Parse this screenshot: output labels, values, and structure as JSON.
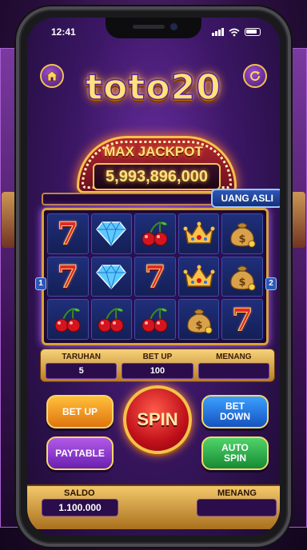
{
  "status": {
    "time": "12:41"
  },
  "header": {
    "logo": "toto20"
  },
  "jackpot": {
    "title": "MAX JACKPOT",
    "value": "5,993,896,000"
  },
  "badge": {
    "label": "UANG ASLI"
  },
  "reels": {
    "line_left": "1",
    "line_right": "2",
    "grid": [
      [
        "seven",
        "seven",
        "cherry"
      ],
      [
        "diamond",
        "diamond",
        "cherry"
      ],
      [
        "cherry",
        "seven",
        "cherry"
      ],
      [
        "crown",
        "crown",
        "moneybag"
      ],
      [
        "moneybag",
        "moneybag",
        "seven"
      ]
    ]
  },
  "bet": {
    "taruhan_label": "TARUHAN",
    "taruhan_value": "5",
    "betup_label": "BET UP",
    "betup_value": "100",
    "menang_label": "MENANG",
    "menang_value": ""
  },
  "buttons": {
    "bet_up": "BET UP",
    "paytable": "PAYTABLE",
    "spin": "SPIN",
    "bet_down": "BET\nDOWN",
    "auto_spin": "AUTO\nSPIN"
  },
  "footer": {
    "saldo_label": "SALDO",
    "saldo_value": "1.100.000",
    "menang_label": "MENANG",
    "menang_value": ""
  },
  "colors": {
    "gold": "#f6c24a",
    "purple": "#3c1766",
    "red": "#c0101a"
  }
}
